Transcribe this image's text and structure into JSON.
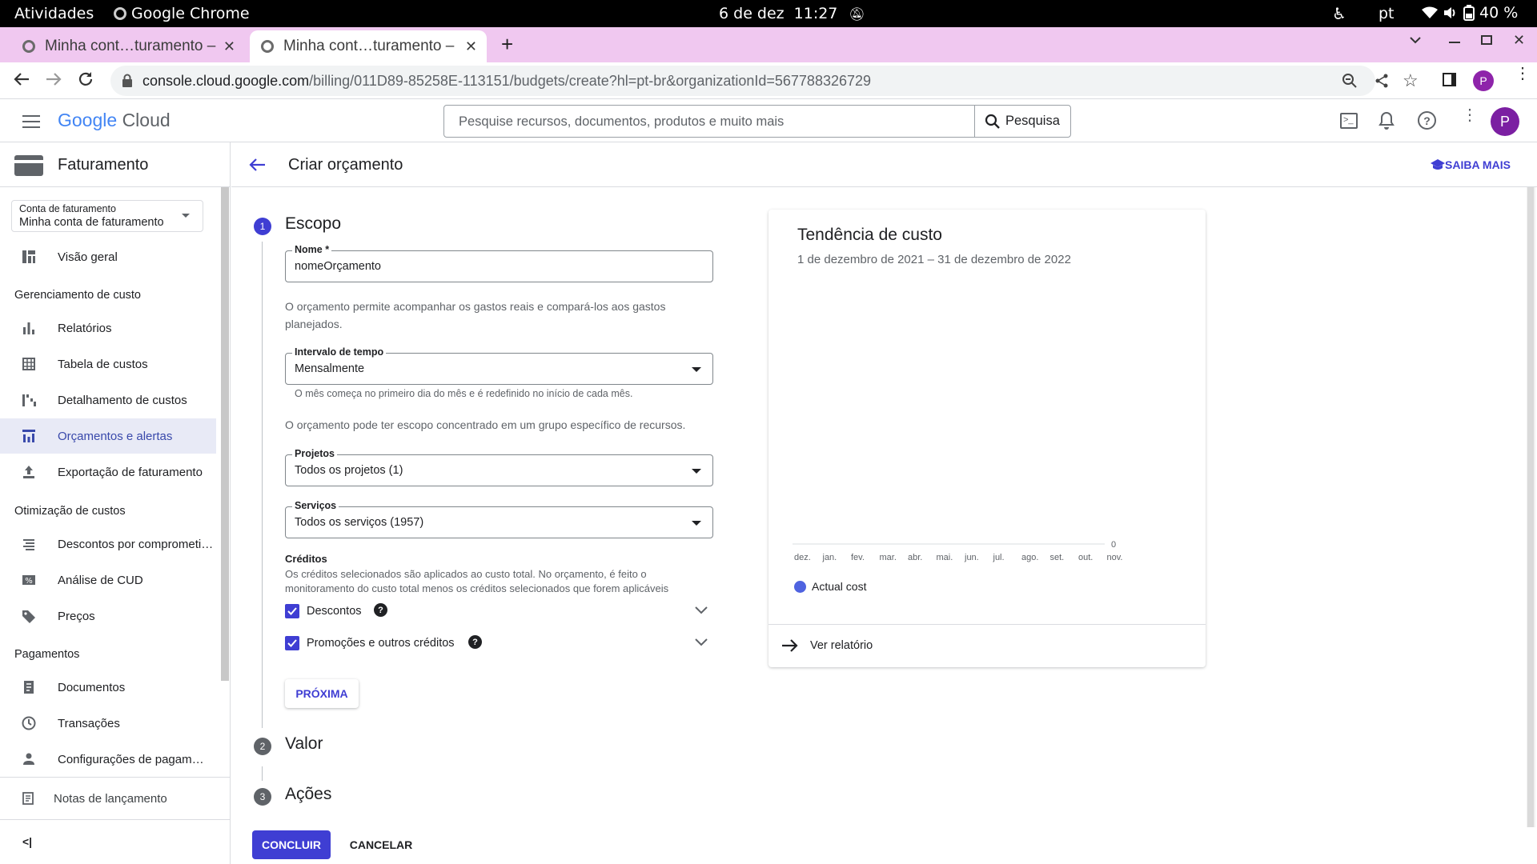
{
  "os_bar": {
    "activities": "Atividades",
    "app_name": "Google Chrome",
    "date": "6 de dez",
    "time": "11:27",
    "lang": "pt",
    "battery": "40 %"
  },
  "browser": {
    "tabs": [
      {
        "title": "Minha cont…turamento –",
        "active": false
      },
      {
        "title": "Minha cont…turamento –",
        "active": true
      }
    ],
    "url_host": "console.cloud.google.com",
    "url_path": "/billing/011D89-85258E-113151/budgets/create?hl=pt-br&organizationId=567788326729",
    "profile_initial": "P"
  },
  "gcp": {
    "logo_google": "Google",
    "logo_cloud": "Cloud",
    "search_placeholder": "Pesquise recursos, documentos, produtos e muito mais",
    "search_button": "Pesquisa",
    "avatar_initial": "P"
  },
  "sidebar": {
    "title": "Faturamento",
    "account_label": "Conta de faturamento",
    "account_value": "Minha conta de faturamento",
    "overview": "Visão geral",
    "section_cost_mgmt": "Gerenciamento de custo",
    "cost_mgmt_items": [
      "Relatórios",
      "Tabela de custos",
      "Detalhamento de custos",
      "Orçamentos e alertas",
      "Exportação de faturamento"
    ],
    "section_cost_opt": "Otimização de custos",
    "cost_opt_items": [
      "Descontos por comprometi…",
      "Análise de CUD",
      "Preços"
    ],
    "section_payments": "Pagamentos",
    "payment_items": [
      "Documentos",
      "Transações",
      "Configurações de pagam…"
    ],
    "release_notes": "Notas de lançamento",
    "collapse": "<|"
  },
  "page": {
    "title": "Criar orçamento",
    "learn_more": "SAIBA MAIS"
  },
  "form": {
    "step1": {
      "num": "1",
      "title": "Escopo"
    },
    "name_label": "Nome *",
    "name_value": "nomeOrçamento",
    "name_help": "O orçamento permite acompanhar os gastos reais e compará-los aos gastos planejados.",
    "interval_label": "Intervalo de tempo",
    "interval_value": "Mensalmente",
    "interval_help": "O mês começa no primeiro dia do mês e é redefinido no início de cada mês.",
    "scope_help": "O orçamento pode ter escopo concentrado em um grupo específico de recursos.",
    "projects_label": "Projetos",
    "projects_value": "Todos os projetos (1)",
    "services_label": "Serviços",
    "services_value": "Todos os serviços (1957)",
    "credits_title": "Créditos",
    "credits_help": "Os créditos selecionados são aplicados ao custo total. No orçamento, é feito o monitoramento do custo total menos os créditos selecionados que forem aplicáveis",
    "credit_discounts": "Descontos",
    "credit_promotions": "Promoções e outros créditos",
    "next_button": "PRÓXIMA",
    "step2": {
      "num": "2",
      "title": "Valor"
    },
    "step3": {
      "num": "3",
      "title": "Ações"
    },
    "finish_button": "CONCLUIR",
    "cancel_button": "CANCELAR"
  },
  "chart_card": {
    "title": "Tendência de custo",
    "subtitle": "1 de dezembro de 2021 – 31 de dezembro de 2022",
    "view_report": "Ver relatório"
  },
  "chart_data": {
    "type": "line",
    "title": "Tendência de custo",
    "categories": [
      "dez.",
      "jan.",
      "fev.",
      "mar.",
      "abr.",
      "mai.",
      "jun.",
      "jul.",
      "ago.",
      "set.",
      "out.",
      "nov."
    ],
    "y_tick": "0",
    "series": [
      {
        "name": "Actual cost",
        "color": "#4f63e0",
        "values": [
          0,
          0,
          0,
          0,
          0,
          0,
          0,
          0,
          0,
          0,
          0,
          0
        ]
      }
    ],
    "legend": "bottom-left"
  },
  "colors": {
    "accent": "#3f3ed3",
    "tabstrip": "#f0c8f0",
    "selected_nav_bg": "#e8eaf6"
  }
}
